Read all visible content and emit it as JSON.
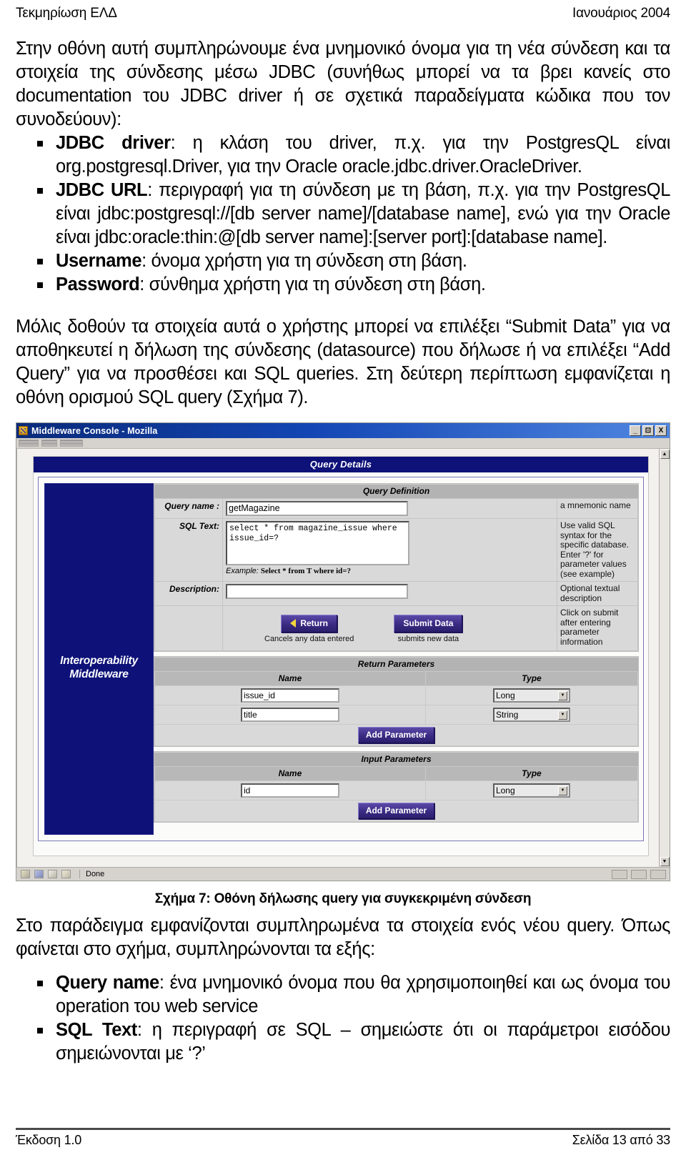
{
  "header": {
    "left": "Τεκμηρίωση ΕΛΔ",
    "right": "Ιανουάριος 2004"
  },
  "intro_paragraph": "Στην οθόνη αυτή συμπληρώνουμε ένα μνημονικό όνομα για τη νέα σύνδεση και τα στοιχεία της σύνδεσης μέσω JDBC (συνήθως μπορεί να τα βρει κανείς στο documentation του JDBC driver ή σε σχετικά παραδείγματα κώδικα που τον συνοδεύουν):",
  "bullets_top": [
    {
      "term": "JDBC driver",
      "text": ": η κλάση του driver, π.χ. για την PostgresQL είναι org.postgresql.Driver, για την Oracle oracle.jdbc.driver.OracleDriver."
    },
    {
      "term": "JDBC URL",
      "text": ": περιγραφή για τη σύνδεση με τη βάση, π.χ. για την PostgresQL είναι jdbc:postgresql://[db server name]/[database name], ενώ για την Oracle είναι jdbc:oracle:thin:@[db server name]:[server port]:[database name]."
    },
    {
      "term": "Username",
      "text": ": όνομα χρήστη για τη σύνδεση στη βάση."
    },
    {
      "term": "Password",
      "text": ": σύνθημα χρήστη για τη σύνδεση στη βάση."
    }
  ],
  "paragraph_after_bullets": "Μόλις δοθούν τα στοιχεία αυτά ο χρήστης μπορεί να επιλέξει “Submit Data” για να αποθηκευτεί η δήλωση της σύνδεσης (datasource) που δήλωσε ή να επιλέξει “Add Query” για να προσθέσει και SQL queries. Στη δεύτερη περίπτωση εμφανίζεται η οθόνη ορισμού SQL query (Σχήμα 7).",
  "figure": {
    "window": {
      "title": "Middleware Console - Mozilla",
      "minimize_label": "_",
      "maximize_label": "⊡",
      "close_label": "X"
    },
    "page_header": "Query Details",
    "sidebar": {
      "brand_line1": "Interoperability",
      "brand_line2": "Middleware"
    },
    "query_definition": {
      "section_title": "Query Definition",
      "rows": [
        {
          "label": "Query name :",
          "value": "getMagazine",
          "hint": "a mnemonic name"
        },
        {
          "label": "SQL Text:",
          "value": "select * from magazine_issue where\nissue_id=?",
          "example_prefix": "Example:",
          "example_text": "Select * from T where id=?",
          "hint": "Use valid SQL syntax for the specific database. Enter '?' for parameter values (see example)"
        },
        {
          "label": "Description:",
          "value": "",
          "hint": "Optional textual description"
        }
      ],
      "buttons": [
        {
          "label": "Return",
          "caption": "Cancels any data entered",
          "icon": "arrow-left-icon"
        },
        {
          "label": "Submit Data",
          "caption": "submits new data",
          "icon": ""
        }
      ],
      "buttons_hint": "Click on submit after entering parameter information"
    },
    "return_parameters": {
      "section_title": "Return Parameters",
      "columns": [
        "Name",
        "Type"
      ],
      "rows": [
        {
          "name": "issue_id",
          "type": "Long"
        },
        {
          "name": "title",
          "type": "String"
        }
      ],
      "add_label": "Add Parameter"
    },
    "input_parameters": {
      "section_title": "Input Parameters",
      "columns": [
        "Name",
        "Type"
      ],
      "rows": [
        {
          "name": "id",
          "type": "Long"
        }
      ],
      "add_label": "Add Parameter"
    },
    "statusbar": {
      "text": "Done"
    }
  },
  "caption": "Σχήμα 7: Οθόνη δήλωσης query για συγκεκριμένη σύνδεση",
  "paragraph_after_figure": "Στο παράδειγμα εμφανίζονται συμπληρωμένα τα στοιχεία ενός νέου query. Όπως φαίνεται στο σχήμα, συμπληρώνονται τα εξής:",
  "bullets_bottom": [
    {
      "term": "Query name",
      "text": ": ένα μνημονικό όνομα που θα χρησιμοποιηθεί και ως όνομα του operation του web service"
    },
    {
      "term": "SQL Text",
      "text": ": η περιγραφή σε SQL – σημειώστε ότι οι παράμετροι εισόδου σημειώνονται με ‘?’"
    }
  ],
  "footer": {
    "left": "Έκδοση 1.0",
    "right": "Σελίδα 13 από 33"
  }
}
